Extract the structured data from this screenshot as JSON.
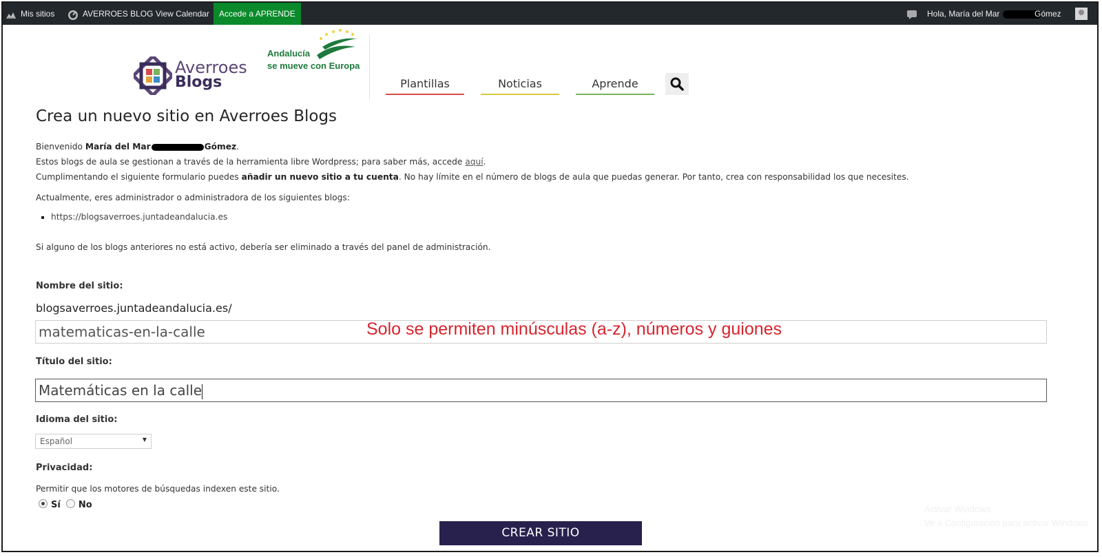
{
  "adminbar": {
    "my_sites": "Mis sitios",
    "site_name": "AVERROES BLOG",
    "calendar": "View Calendar",
    "aprende": "Accede a APRENDE",
    "greeting": "Hola, María del Mar",
    "surname": "Gómez"
  },
  "header": {
    "logo_line1": "Averroes",
    "logo_line2": "Blogs",
    "euro_line1": "Andalucía",
    "euro_line2": "se mueve con Europa",
    "nav": [
      {
        "label": "Plantillas",
        "color": "#d94a4a"
      },
      {
        "label": "Noticias",
        "color": "#d7c83a"
      },
      {
        "label": "Aprende",
        "color": "#7bb25b"
      }
    ]
  },
  "content": {
    "title": "Crea un nuevo sitio en Averroes Blogs",
    "welcome_prefix": "Bienvenido ",
    "welcome_name": "María del Mar",
    "welcome_surname": "Gómez",
    "welcome_suffix": ".",
    "info_text": "Estos blogs de aula se gestionan a través de la herramienta libre Wordpress; para saber más, accede ",
    "info_link": "aquí",
    "info_end": ".",
    "form_intro_1": "Cumplimentando el siguiente formulario puedes ",
    "form_intro_bold": "añadir un nuevo sitio a tu cuenta",
    "form_intro_2": ". No hay límite en el número de blogs de aula que puedas generar. Por tanto, crea con responsabilidad los que necesites.",
    "admin_of": "Actualmente, eres administrador o administradora de los siguientes blogs:",
    "blogs": [
      "https://blogsaverroes.juntadeandalucia.es"
    ],
    "inactive_note": "Si alguno de los blogs anteriores no está activo, debería ser eliminado a través del panel de administración."
  },
  "form": {
    "site_name_label": "Nombre del sitio:",
    "domain": "blogsaverroes.juntadeandalucia.es/",
    "site_name_value": "matematicas-en-la-calle",
    "site_name_hint": "Solo se permiten minúsculas (a-z), números y guiones",
    "site_title_label": "Título del sitio:",
    "site_title_value": "Matemáticas en la calle",
    "language_label": "Idioma del sitio:",
    "language_value": "Español",
    "privacy_label": "Privacidad:",
    "privacy_question": "Permitir que los motores de búsquedas indexen este sitio.",
    "privacy_yes": "Sí",
    "privacy_no": "No",
    "submit": "CREAR SITIO"
  },
  "watermark": {
    "line1": "Activar Windows",
    "line2": "Ve a Configuración para activar Windows."
  }
}
